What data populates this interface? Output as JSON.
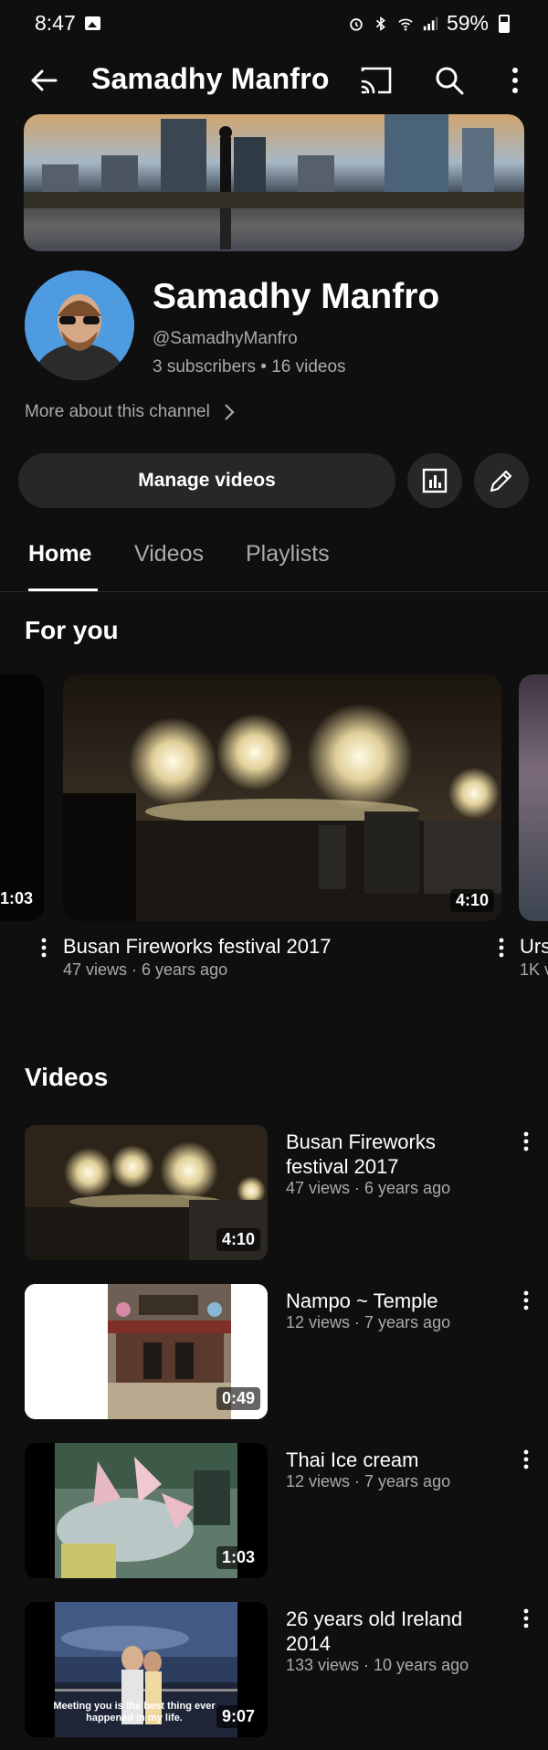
{
  "status_bar": {
    "time": "8:47",
    "battery": "59%"
  },
  "app_bar": {
    "title": "Samadhy Manfro"
  },
  "channel": {
    "name": "Samadhy Manfro",
    "handle": "@SamadhyManfro",
    "stats": "3 subscribers • 16 videos",
    "more_about": "More about this channel"
  },
  "actions": {
    "manage_label": "Manage videos"
  },
  "tabs": [
    {
      "label": "Home",
      "active": true
    },
    {
      "label": "Videos",
      "active": false
    },
    {
      "label": "Playlists",
      "active": false
    }
  ],
  "for_you": {
    "heading": "For you",
    "left_peek_duration": "1:03",
    "main": {
      "title": "Busan Fireworks festival 2017",
      "meta": "47 views · 6 years ago",
      "duration": "4:10"
    },
    "right_peek": {
      "title": "Urs",
      "meta": "1K v"
    }
  },
  "videos": {
    "heading": "Videos",
    "items": [
      {
        "title": "Busan Fireworks festival 2017",
        "meta": "47 views · 6 years ago",
        "duration": "4:10"
      },
      {
        "title": "Nampo ~ Temple",
        "meta": "12 views · 7 years ago",
        "duration": "0:49"
      },
      {
        "title": "Thai Ice cream",
        "meta": "12 views · 7 years ago",
        "duration": "1:03"
      },
      {
        "title": "26 years old Ireland 2014",
        "meta": "133 views · 10 years ago",
        "duration": "9:07",
        "caption": "Meeting you is the best thing ever happened in my life."
      }
    ]
  }
}
